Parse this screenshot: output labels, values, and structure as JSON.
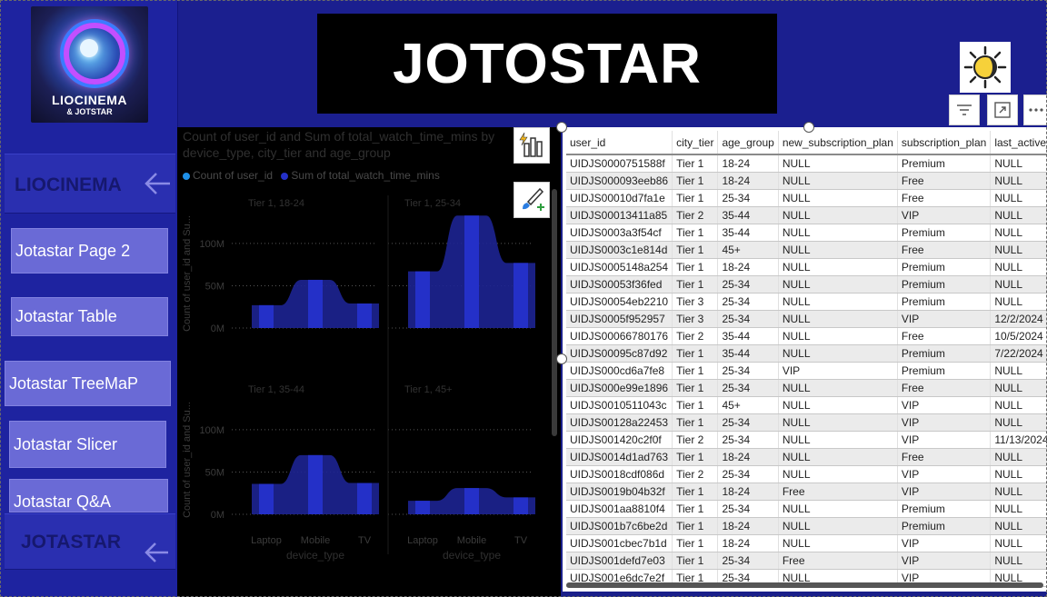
{
  "app": {
    "logo_line1": "LIOCINEMA",
    "logo_line2": "& JOTSTAR",
    "title": "JOTOSTAR"
  },
  "nav": {
    "section1": "LIOCINEMA",
    "buttons": [
      "Jotastar Page 2",
      "Jotastar Table",
      "Jotastar TreeMaP",
      "Jotastar Slicer",
      "Jotastar Q&A"
    ],
    "section2": "JOTASTAR",
    "back_icon": "arrow-left-icon"
  },
  "toolbar": {
    "filter_icon": "filter-icon",
    "focus_icon": "focus-mode-icon",
    "more_icon": "more-options-icon",
    "theme_icon": "sun-moon-icon"
  },
  "chart": {
    "title": "Count of user_id and Sum of total_watch_time_mins by device_type, city_tier and age_group",
    "legend": [
      {
        "label": "Count of user_id",
        "color": "#1e90e8"
      },
      {
        "label": "Sum of total_watch_time_mins",
        "color": "#2430c8"
      }
    ],
    "ylabel": "Count of user_id and Su...",
    "xlabel": "device_type",
    "y_ticks": [
      "100M",
      "50M",
      "0M"
    ],
    "x_ticks": [
      "Laptop",
      "Mobile",
      "TV"
    ],
    "panels": [
      "Tier 1, 18-24",
      "Tier 1, 25-34",
      "Tier 1, 35-44",
      "Tier 1, 45+"
    ]
  },
  "chart_data": {
    "type": "bar",
    "categories": [
      "Laptop",
      "Mobile",
      "TV"
    ],
    "ylim": [
      0,
      130000000
    ],
    "panels": [
      {
        "name": "Tier 1, 18-24",
        "values": [
          27000000,
          57000000,
          29000000
        ]
      },
      {
        "name": "Tier 1, 25-34",
        "values": [
          67000000,
          133000000,
          77000000
        ]
      },
      {
        "name": "Tier 1, 35-44",
        "values": [
          36000000,
          70000000,
          37000000
        ]
      },
      {
        "name": "Tier 1, 45+",
        "values": [
          16000000,
          31000000,
          20000000
        ]
      }
    ]
  },
  "table": {
    "columns": [
      "user_id",
      "city_tier",
      "age_group",
      "new_subscription_plan",
      "subscription_plan",
      "last_active_"
    ],
    "rows": [
      [
        "UIDJS0000751588f",
        "Tier 1",
        "18-24",
        "NULL",
        "Premium",
        "NULL"
      ],
      [
        "UIDJS000093eeb86",
        "Tier 1",
        "18-24",
        "NULL",
        "Free",
        "NULL"
      ],
      [
        "UIDJS00010d7fa1e",
        "Tier 1",
        "25-34",
        "NULL",
        "Free",
        "NULL"
      ],
      [
        "UIDJS00013411a85",
        "Tier 2",
        "35-44",
        "NULL",
        "VIP",
        "NULL"
      ],
      [
        "UIDJS0003a3f54cf",
        "Tier 1",
        "35-44",
        "NULL",
        "Premium",
        "NULL"
      ],
      [
        "UIDJS0003c1e814d",
        "Tier 1",
        "45+",
        "NULL",
        "Free",
        "NULL"
      ],
      [
        "UIDJS0005148a254",
        "Tier 1",
        "18-24",
        "NULL",
        "Premium",
        "NULL"
      ],
      [
        "UIDJS00053f36fed",
        "Tier 1",
        "25-34",
        "NULL",
        "Premium",
        "NULL"
      ],
      [
        "UIDJS00054eb2210",
        "Tier 3",
        "25-34",
        "NULL",
        "Premium",
        "NULL"
      ],
      [
        "UIDJS0005f952957",
        "Tier 3",
        "25-34",
        "NULL",
        "VIP",
        "12/2/2024"
      ],
      [
        "UIDJS00066780176",
        "Tier 2",
        "35-44",
        "NULL",
        "Free",
        "10/5/2024"
      ],
      [
        "UIDJS00095c87d92",
        "Tier 1",
        "35-44",
        "NULL",
        "Premium",
        "7/22/2024"
      ],
      [
        "UIDJS000cd6a7fe8",
        "Tier 1",
        "25-34",
        "VIP",
        "Premium",
        "NULL"
      ],
      [
        "UIDJS000e99e1896",
        "Tier 1",
        "25-34",
        "NULL",
        "Free",
        "NULL"
      ],
      [
        "UIDJS0010511043c",
        "Tier 1",
        "45+",
        "NULL",
        "VIP",
        "NULL"
      ],
      [
        "UIDJS00128a22453",
        "Tier 1",
        "25-34",
        "NULL",
        "VIP",
        "NULL"
      ],
      [
        "UIDJS001420c2f0f",
        "Tier 2",
        "25-34",
        "NULL",
        "VIP",
        "11/13/2024"
      ],
      [
        "UIDJS0014d1ad763",
        "Tier 1",
        "18-24",
        "NULL",
        "Free",
        "NULL"
      ],
      [
        "UIDJS0018cdf086d",
        "Tier 2",
        "25-34",
        "NULL",
        "VIP",
        "NULL"
      ],
      [
        "UIDJS0019b04b32f",
        "Tier 1",
        "18-24",
        "Free",
        "VIP",
        "NULL"
      ],
      [
        "UIDJS001aa8810f4",
        "Tier 1",
        "25-34",
        "NULL",
        "Premium",
        "NULL"
      ],
      [
        "UIDJS001b7c6be2d",
        "Tier 1",
        "18-24",
        "NULL",
        "Premium",
        "NULL"
      ],
      [
        "UIDJS001cbec7b1d",
        "Tier 1",
        "18-24",
        "NULL",
        "VIP",
        "NULL"
      ],
      [
        "UIDJS001defd7e03",
        "Tier 1",
        "25-34",
        "Free",
        "VIP",
        "NULL"
      ],
      [
        "UIDJS001e6dc7e2f",
        "Tier 1",
        "25-34",
        "NULL",
        "VIP",
        "NULL"
      ]
    ]
  }
}
